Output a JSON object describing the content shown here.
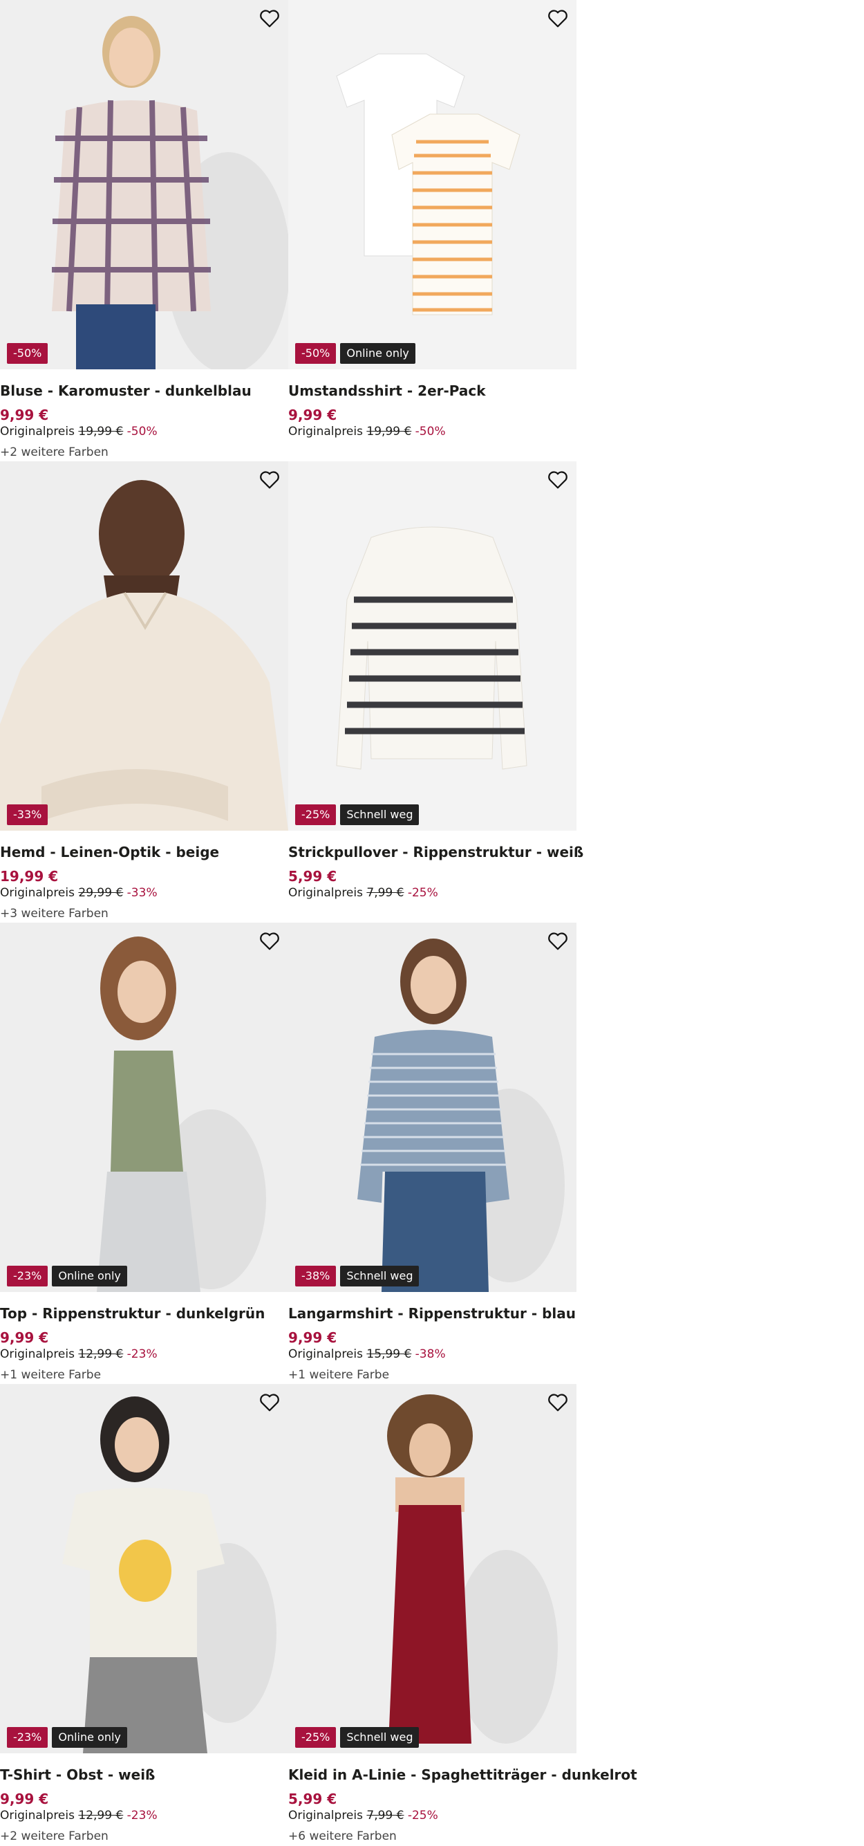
{
  "products": [
    {
      "title": "Bluse - Karomuster - dunkelblau",
      "price": "9,99 €",
      "orig_label": "Originalpreis",
      "orig_price": "19,99 €",
      "discount": "-50%",
      "badge_sale": "-50%",
      "badge_flag": "",
      "colors": "+2 weitere Farben"
    },
    {
      "title": "Umstandsshirt - 2er-Pack",
      "price": "9,99 €",
      "orig_label": "Originalpreis",
      "orig_price": "19,99 €",
      "discount": "-50%",
      "badge_sale": "-50%",
      "badge_flag": "Online only",
      "colors": ""
    },
    {
      "title": "Hemd - Leinen-Optik - beige",
      "price": "19,99 €",
      "orig_label": "Originalpreis",
      "orig_price": "29,99 €",
      "discount": "-33%",
      "badge_sale": "-33%",
      "badge_flag": "",
      "colors": "+3 weitere Farben"
    },
    {
      "title": "Strickpullover - Rippenstruktur - weiß",
      "price": "5,99 €",
      "orig_label": "Originalpreis",
      "orig_price": "7,99 €",
      "discount": "-25%",
      "badge_sale": "-25%",
      "badge_flag": "Schnell weg",
      "colors": ""
    },
    {
      "title": "Top - Rippenstruktur - dunkelgrün",
      "price": "9,99 €",
      "orig_label": "Originalpreis",
      "orig_price": "12,99 €",
      "discount": "-23%",
      "badge_sale": "-23%",
      "badge_flag": "Online only",
      "colors": "+1 weitere Farbe"
    },
    {
      "title": "Langarmshirt - Rippenstruktur - blau",
      "price": "9,99 €",
      "orig_label": "Originalpreis",
      "orig_price": "15,99 €",
      "discount": "-38%",
      "badge_sale": "-38%",
      "badge_flag": "Schnell weg",
      "colors": "+1 weitere Farbe"
    },
    {
      "title": "T-Shirt - Obst - weiß",
      "price": "9,99 €",
      "orig_label": "Originalpreis",
      "orig_price": "12,99 €",
      "discount": "-23%",
      "badge_sale": "-23%",
      "badge_flag": "Online only",
      "colors": "+2 weitere Farben"
    },
    {
      "title": "Kleid in A-Linie - Spaghettiträger - dunkelrot",
      "price": "5,99 €",
      "orig_label": "Originalpreis",
      "orig_price": "7,99 €",
      "discount": "-25%",
      "badge_sale": "-25%",
      "badge_flag": "Schnell weg",
      "colors": "+6 weitere Farben"
    }
  ],
  "icons": {
    "favorite": "heart-outline-icon"
  },
  "colors": {
    "sale": "#a8123e",
    "flag": "#222222",
    "image_bg": "#f1f1f1"
  }
}
